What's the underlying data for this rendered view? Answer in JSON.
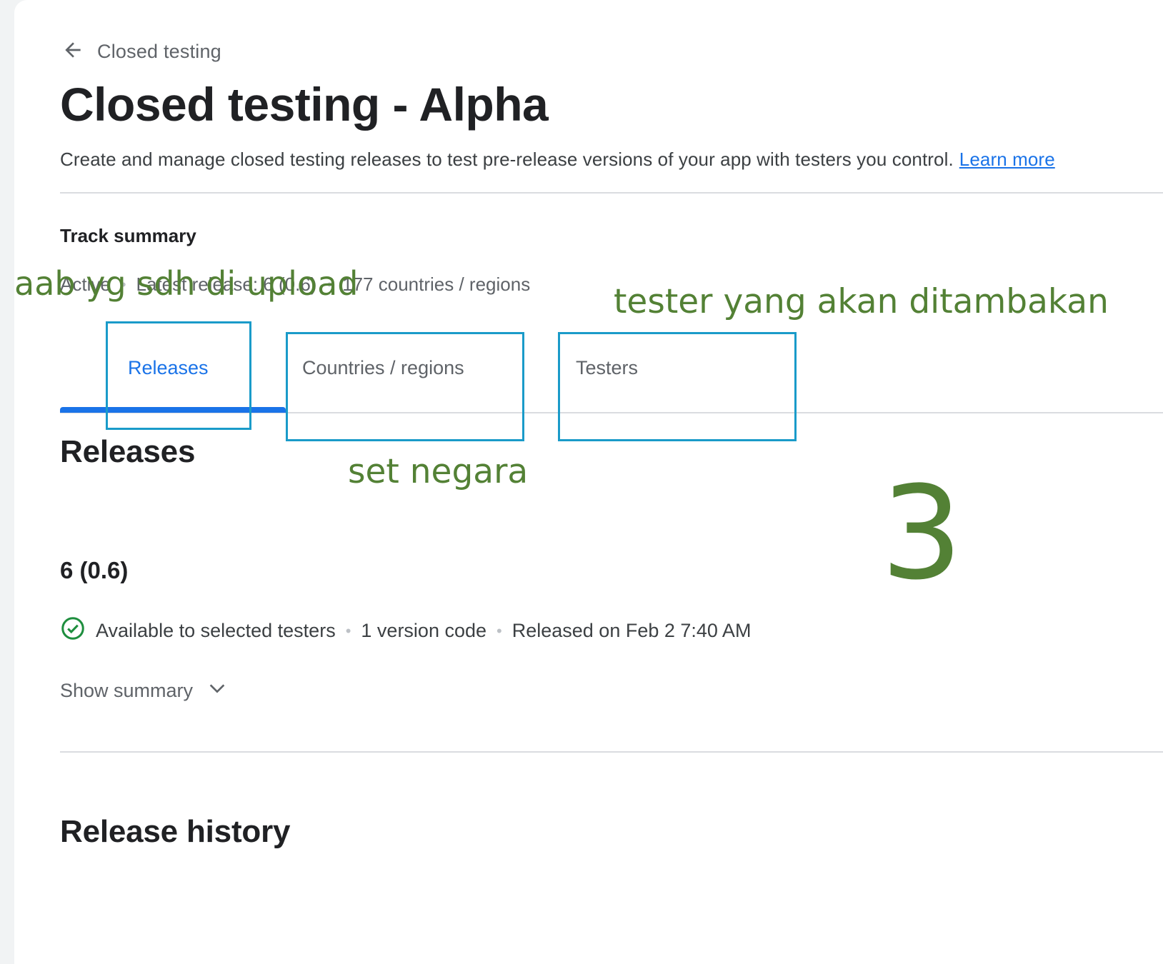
{
  "breadcrumb": {
    "back_label": "Closed testing"
  },
  "header": {
    "title": "Closed testing - Alpha",
    "description": "Create and manage closed testing releases to test pre-release versions of your app with testers you control.",
    "learn_more": "Learn more"
  },
  "track_summary": {
    "heading": "Track summary",
    "status": "Active",
    "latest_release": "Latest release: 6 (0.6)",
    "countries": "177 countries / regions"
  },
  "tabs": [
    {
      "label": "Releases",
      "active": true
    },
    {
      "label": "Countries / regions",
      "active": false
    },
    {
      "label": "Testers",
      "active": false
    }
  ],
  "releases_section": {
    "heading": "Releases",
    "release": {
      "name": "6 (0.6)",
      "status": "Available to selected testers",
      "version_codes": "1 version code",
      "released_on": "Released on Feb 2 7:40 AM",
      "show_summary": "Show summary"
    }
  },
  "release_history": {
    "heading": "Release history"
  },
  "annotations": {
    "aab_note": "aab yg sdh di upload",
    "tester_note": "tester yang akan ditambakan",
    "country_note": "set negara",
    "step_number": "3",
    "color": "#538135",
    "box_color": "#1a9bc9"
  },
  "colors": {
    "accent": "#1a73e8",
    "success": "#1e8e3e"
  }
}
